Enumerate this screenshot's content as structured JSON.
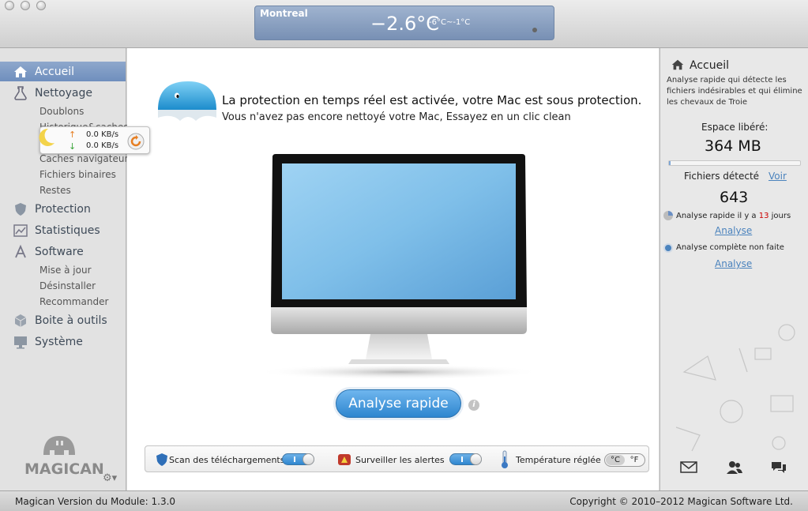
{
  "weather": {
    "city": "Montreal",
    "temperature": "−2.6°C",
    "range": "-6°C~-1°C"
  },
  "sidebar": {
    "items": [
      {
        "label": "Accueil"
      },
      {
        "label": "Nettoyage"
      },
      {
        "label": "Protection"
      },
      {
        "label": "Statistiques"
      },
      {
        "label": "Software"
      },
      {
        "label": "Boite à outils"
      },
      {
        "label": "Système"
      }
    ],
    "nettoyage_sub": [
      "Doublons",
      "Historique&caches",
      "Caches navigateur",
      "Fichiers binaires",
      "Restes"
    ],
    "software_sub": [
      "Mise à jour",
      "Désinstaller",
      "Recommander"
    ],
    "brand": "MAGICAN"
  },
  "speed": {
    "upload": "0.0 KB/s",
    "download": "0.0 KB/s"
  },
  "main": {
    "status_title": "La protection en temps réel est activée, votre Mac est sous protection.",
    "status_sub": "Vous n'avez pas encore nettoyé votre Mac, Essayez en un clic clean",
    "scan_button": "Analyse rapide",
    "info_glyph": "i"
  },
  "toggles": {
    "download_scan": "Scan des téléchargements",
    "alerts": "Surveiller les alertes",
    "temperature": "Température réglée",
    "unit_c": "°C",
    "unit_f": "°F"
  },
  "right_panel": {
    "title": "Accueil",
    "description": "Analyse rapide qui détecte les fichiers indésirables et qui élimine les chevaux de Troie",
    "freed_label": "Espace libéré:",
    "freed_value": "364 MB",
    "freed_fraction": 0.015,
    "files_label": "Fichiers détecté",
    "files_link": "Voir",
    "files_value": "643",
    "quick_text_a": "Analyse rapide il y a ",
    "quick_days": "13",
    "quick_text_b": " jours",
    "quick_link": "Analyse",
    "full_text": "Analyse complète non faite",
    "full_link": "Analyse"
  },
  "footer": {
    "version": "Magican Version du Module: 1.3.0",
    "copyright": "Copyright © 2010–2012 Magican Software Ltd."
  },
  "colors": {
    "accent": "#3b8ad4",
    "sidebar_active": "#7c9ac4",
    "link": "#4b83bd",
    "red": "#cc0000"
  }
}
